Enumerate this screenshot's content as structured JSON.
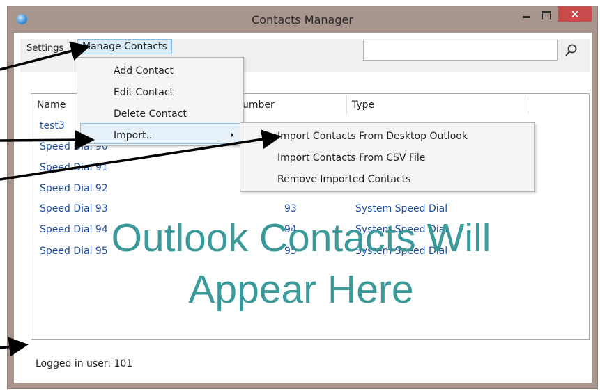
{
  "window": {
    "title": "Contacts Manager",
    "close_label": "×"
  },
  "menu": {
    "settings_label": "Settings",
    "manage_label": "Manage Contacts"
  },
  "dropdown": {
    "items": [
      "Add Contact",
      "Edit Contact",
      "Delete Contact",
      "Import.."
    ]
  },
  "submenu": {
    "items": [
      "Import Contacts From Desktop Outlook",
      "Import Contacts From CSV File",
      "Remove Imported Contacts"
    ]
  },
  "search": {
    "value": ""
  },
  "list": {
    "headers": [
      "Name",
      "umber",
      "Type"
    ],
    "rows": [
      {
        "name": "test3",
        "number": "",
        "type": ""
      },
      {
        "name": "Speed Dial 90",
        "number": "",
        "type": ""
      },
      {
        "name": "Speed Dial 91",
        "number": "",
        "type": ""
      },
      {
        "name": "Speed Dial 92",
        "number": "",
        "type": ""
      },
      {
        "name": "Speed Dial 93",
        "number": "93",
        "type": "System Speed Dial"
      },
      {
        "name": "Speed Dial 94",
        "number": "94",
        "type": "System Speed Dial"
      },
      {
        "name": "Speed Dial 95",
        "number": "95",
        "type": "System Speed Dial"
      }
    ]
  },
  "overlay": {
    "line1": "Outlook Contacts Will",
    "line2": "Appear Here"
  },
  "status": {
    "text": "Logged in user: 101"
  },
  "colors": {
    "overlay_text": "#3a9a99",
    "frame": "#a8958e",
    "selection": "#d6ebf7",
    "close_button": "#c94b4b",
    "link_text": "#1f4ea1"
  }
}
